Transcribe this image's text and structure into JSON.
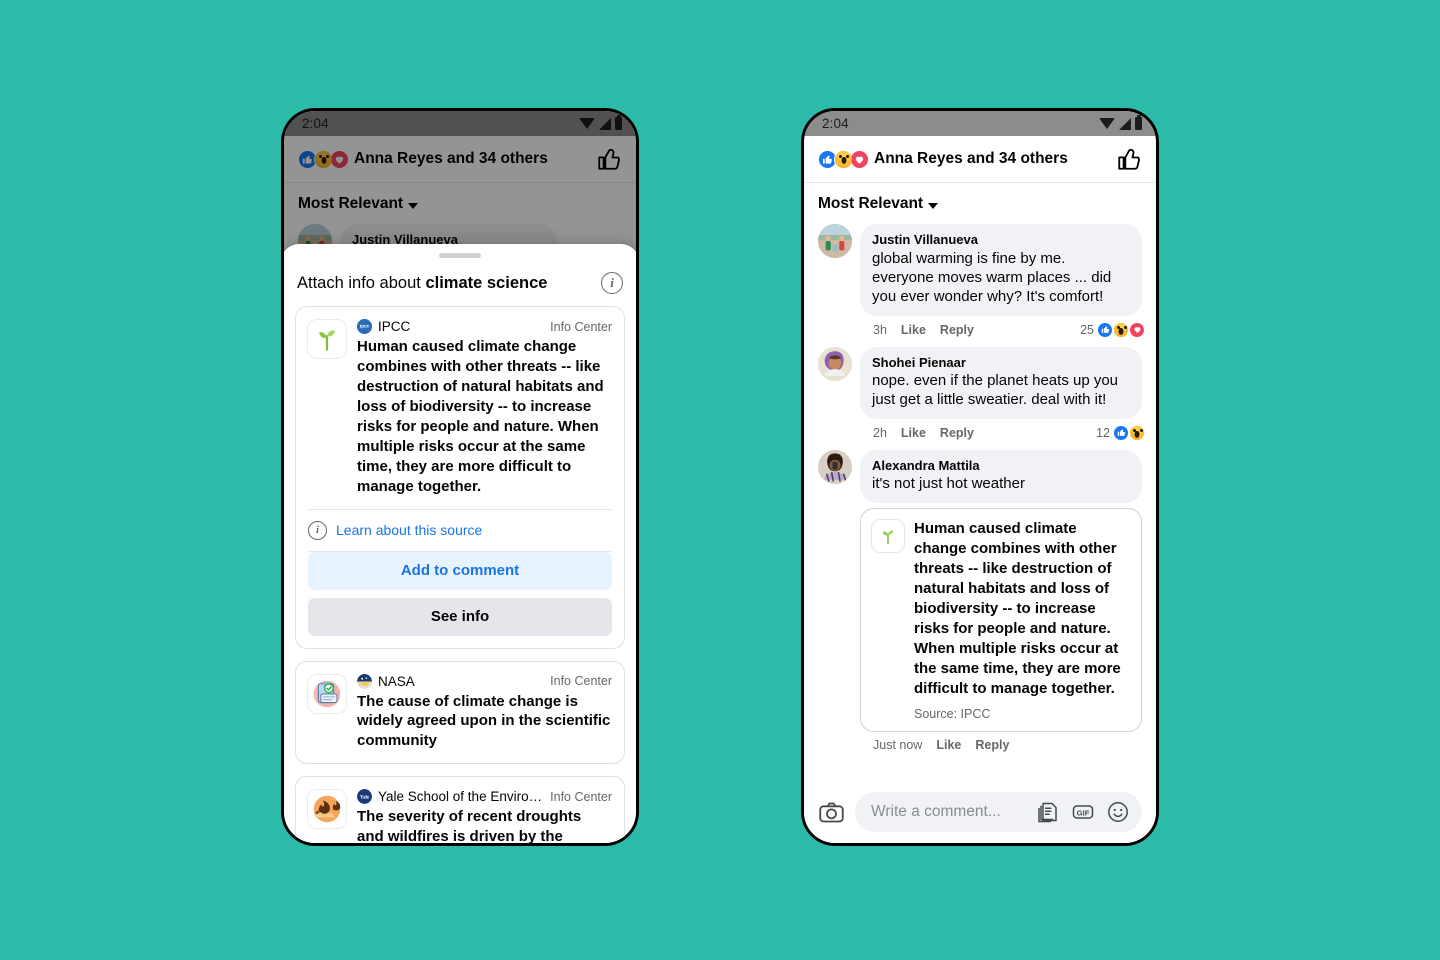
{
  "background_color": "#2bbba8",
  "status_bar": {
    "time": "2:04",
    "icons": [
      "wifi-icon",
      "signal-icon",
      "battery-icon"
    ]
  },
  "reactions_header": {
    "reactions": [
      "like-reaction",
      "wow-reaction",
      "love-reaction"
    ],
    "label": "Anna Reyes and 34 others",
    "thumb_icon": "thumbs-up-outline-icon"
  },
  "sort": {
    "label": "Most Relevant",
    "chevron": "chevron-down-icon"
  },
  "left_phone": {
    "sheet": {
      "title_prefix": "Attach info about ",
      "title_topic": "climate science",
      "info_icon": "info-circle-icon",
      "grabber": "drag-handle",
      "sources": [
        {
          "thumb": "sprout-icon",
          "badge": "ipcc-logo",
          "name": "IPCC",
          "center": "Info Center",
          "quote": "Human caused climate change combines with other threats -- like destruction of natural habitats and loss of biodiversity -- to increase risks for people and nature. When multiple risks occur at the same time, they are more difficult to manage together.",
          "learn_label": "Learn about this source",
          "learn_icon": "info-circle-icon",
          "primary_button": "Add to comment",
          "secondary_button": "See info"
        },
        {
          "thumb": "clipboard-check-icon",
          "badge": "nasa-logo",
          "name": "NASA",
          "center": "Info Center",
          "quote": "The cause of climate change is widely agreed upon in the scientific community"
        },
        {
          "thumb": "wildfire-icon",
          "badge": "yale-logo",
          "name": "Yale School of the Environ...",
          "center": "Info Center",
          "quote": "The severity of recent droughts and wildfires is driven by the changing"
        }
      ]
    },
    "background_comment": {
      "name": "Justin Villanueva",
      "avatar": "family-photo-avatar"
    }
  },
  "right_phone": {
    "comments": [
      {
        "avatar": "family-photo-avatar",
        "name": "Justin Villanueva",
        "text": "global warming is fine by me. everyone moves warm places ... did you ever wonder why? It's comfort!",
        "time": "3h",
        "like_label": "Like",
        "reply_label": "Reply",
        "reaction_count": "25",
        "reactions": [
          "like-reaction",
          "wow-reaction",
          "love-reaction"
        ]
      },
      {
        "avatar": "curly-hair-avatar",
        "name": "Shohei Pienaar",
        "text": "nope. even if the planet heats up you just get a little sweatier. deal with it!",
        "time": "2h",
        "like_label": "Like",
        "reply_label": "Reply",
        "reaction_count": "12",
        "reactions": [
          "like-reaction",
          "wow-reaction"
        ]
      },
      {
        "avatar": "phone-selfie-avatar",
        "name": "Alexandra Mattila",
        "text": "it's not just hot weather",
        "attachment": {
          "thumb": "sprout-icon",
          "text": "Human caused climate change combines with other threats -- like destruction of natural habitats and loss of biodiversity -- to increase risks for people and nature. When multiple risks occur at the same time, they are more difficult to manage together.",
          "source": "Source: IPCC"
        },
        "time": "Just now",
        "like_label": "Like",
        "reply_label": "Reply"
      }
    ],
    "composer": {
      "camera_icon": "camera-icon",
      "placeholder": "Write a comment...",
      "sticker_icon": "sticker-icon",
      "gif_icon": "gif-icon",
      "emoji_icon": "emoji-smiley-icon"
    }
  },
  "colors": {
    "facebook_blue": "#1877f2",
    "link_blue": "#1b74e4",
    "love_red": "#f3425f",
    "wow_yellow": "#f7b125",
    "bubble_gray": "#f0f2f5"
  }
}
